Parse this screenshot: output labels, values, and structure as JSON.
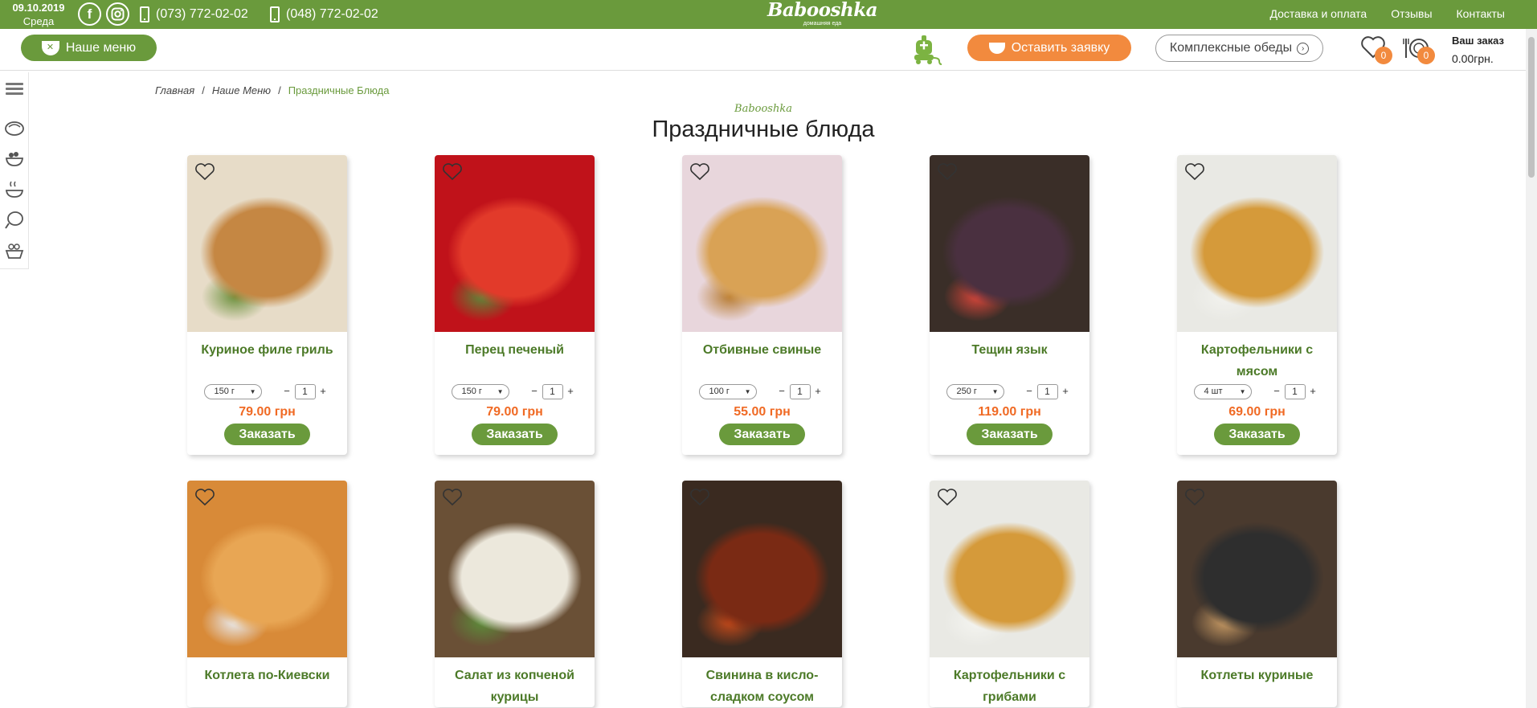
{
  "topbar": {
    "date": "09.10.2019",
    "weekday": "Среда",
    "phone1": "(073) 772-02-02",
    "phone2": "(048) 772-02-02",
    "logo_name": "Babooshka",
    "logo_sub": "домашняя еда",
    "nav": [
      "Доставка и оплата",
      "Отзывы",
      "Контакты"
    ]
  },
  "secbar": {
    "menu_label": "Наше меню",
    "order_label": "Оставить заявку",
    "lunch_label": "Комплексные обеды",
    "fav_count": "0",
    "cart_count": "0",
    "order_title": "Ваш заказ",
    "order_total": "0.00грн."
  },
  "breadcrumb": [
    "Главная",
    "Наше Меню",
    "Праздничные Блюда"
  ],
  "brand_small": "Babooshka",
  "page_title": "Праздничные блюда",
  "order_button": "Заказать",
  "products": [
    {
      "title": "Куриное филе гриль",
      "portion": "150 г",
      "qty": "1",
      "price": "79.00 грн",
      "colors": [
        "#e7dcc8",
        "#c58743",
        "#6a8f3a"
      ]
    },
    {
      "title": "Перец печеный",
      "portion": "150 г",
      "qty": "1",
      "price": "79.00 грн",
      "colors": [
        "#c0121a",
        "#e23a2a",
        "#5a8a3a"
      ]
    },
    {
      "title": "Отбивные свиные",
      "portion": "100 г",
      "qty": "1",
      "price": "55.00 грн",
      "colors": [
        "#e8d6dc",
        "#d9a255",
        "#b77a2e"
      ]
    },
    {
      "title": "Тещин язык",
      "portion": "250 г",
      "qty": "1",
      "price": "119.00 грн",
      "colors": [
        "#3a2e28",
        "#4a3040",
        "#d9463a"
      ]
    },
    {
      "title": "Картофельники с мясом",
      "portion": "4 шт",
      "qty": "1",
      "price": "69.00 грн",
      "colors": [
        "#e9e9e4",
        "#d59a3a",
        "#f2f2ee"
      ]
    },
    {
      "title": "Котлета по-Киевски",
      "portion": "",
      "qty": "",
      "price": "",
      "colors": [
        "#d88a38",
        "#e8a654",
        "#e8ecf2"
      ]
    },
    {
      "title": "Салат из копченой курицы",
      "portion": "",
      "qty": "",
      "price": "",
      "colors": [
        "#6a5036",
        "#ece8dc",
        "#5c8c3a"
      ]
    },
    {
      "title": "Свинина в кисло-сладком соусом",
      "portion": "",
      "qty": "",
      "price": "",
      "colors": [
        "#3a2a20",
        "#7a2a14",
        "#c64a1a"
      ]
    },
    {
      "title": "Картофельники с грибами",
      "portion": "",
      "qty": "",
      "price": "",
      "colors": [
        "#e9e9e4",
        "#d59a3a",
        "#f4f4f0"
      ]
    },
    {
      "title": "Котлеты куриные",
      "portion": "",
      "qty": "",
      "price": "",
      "colors": [
        "#4a3a2e",
        "#2e2e2e",
        "#c79a64"
      ]
    }
  ]
}
